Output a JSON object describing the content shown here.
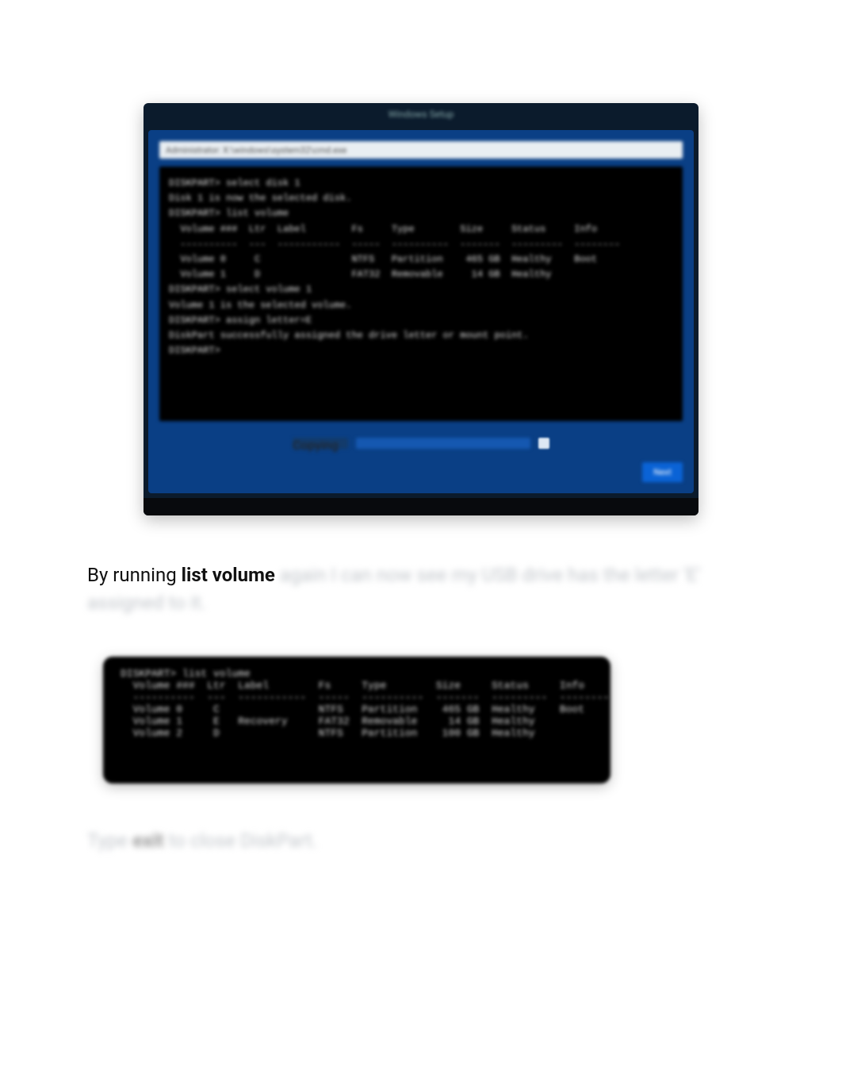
{
  "shot1": {
    "titlebar": "Windows Setup",
    "white_header": "Administrator: X:\\windows\\system32\\cmd.exe",
    "terminal_lines": [
      "DISKPART> select disk 1",
      "Disk 1 is now the selected disk.",
      "DISKPART> list volume",
      "  Volume ###  Ltr  Label        Fs     Type        Size     Status     Info",
      "  ----------  ---  -----------  -----  ----------  -------  ---------  --------",
      "  Volume 0     C                NTFS   Partition    465 GB  Healthy    Boot",
      "  Volume 1     D                FAT32  Removable     14 GB  Healthy",
      "DISKPART> select volume 1",
      "Volume 1 is the selected volume.",
      "DISKPART> assign letter=E",
      "DiskPart successfully assigned the drive letter or mount point.",
      "DISKPART>"
    ],
    "progress_label": "Copying",
    "button_label": "Next"
  },
  "paragraph": {
    "prefix": "By running ",
    "bold": "list volume",
    "rest_blurred": " again I can now see my USB drive has the letter 'E' assigned to it."
  },
  "shot2": {
    "lines": [
      "DISKPART> list volume",
      "  Volume ###  Ltr  Label        Fs     Type        Size     Status     Info",
      "  ----------  ---  -----------  -----  ----------  -------  ---------  --------",
      "  Volume 0     C                NTFS   Partition    465 GB  Healthy    Boot",
      "  Volume 1     E   Recovery     FAT32  Removable     14 GB  Healthy",
      "  Volume 2     D                NTFS   Partition    100 GB  Healthy"
    ]
  },
  "paragraph2": {
    "prefix_blurred": "Type ",
    "bold_blurred": "exit",
    "rest_blurred": " to close DiskPart."
  }
}
